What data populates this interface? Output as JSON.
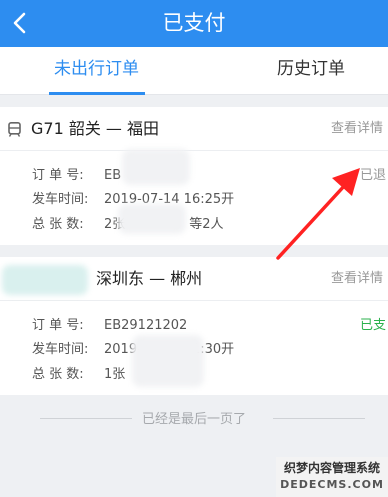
{
  "header": {
    "title": "已支付",
    "back_icon": "chevron-left-icon"
  },
  "tabs": [
    {
      "label": "未出行订单",
      "active": true
    },
    {
      "label": "历史订单",
      "active": false
    }
  ],
  "colors": {
    "brand": "#2d8df0",
    "paid": "#2bb24c",
    "arrow": "#ff2222"
  },
  "orders": [
    {
      "train_icon": "train-icon",
      "route": "G71  韶关 — 福田",
      "detail_link": "查看详情",
      "status": "已退",
      "order_no_label": "订 单 号:",
      "order_no": "EB",
      "depart_label": "发车时间:",
      "depart_time": "2019-07-14   16:25开",
      "count_label": "总 张 数:",
      "count_prefix": "2张",
      "count_suffix": "等2人"
    },
    {
      "route": "深圳东 — 郴州",
      "detail_link": "查看详情",
      "status": "已支",
      "order_no_label": "订 单 号:",
      "order_no": "EB29121202",
      "depart_label": "发车时间:",
      "depart_time": "2019-07-12   21:30开",
      "count_label": "总 张 数:",
      "count_prefix": "1张"
    }
  ],
  "footer": {
    "end_text": "已经是最后一页了"
  },
  "watermark": {
    "main": "织梦内容管理系统",
    "sub": "DEDECMS.COM"
  }
}
